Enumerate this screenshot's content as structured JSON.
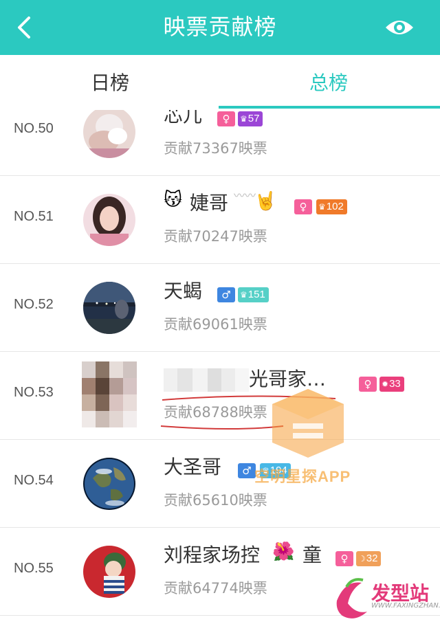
{
  "header": {
    "title": "映票贡献榜"
  },
  "tabs": [
    {
      "label": "日榜",
      "active": false
    },
    {
      "label": "总榜",
      "active": true
    }
  ],
  "accent_color": "#2bc9c0",
  "rows": [
    {
      "rank": "NO.50",
      "name": "芯儿",
      "sex": "♀",
      "level": "57",
      "level_icon": "crown-icon",
      "contribution": "贡献73367映票"
    },
    {
      "rank": "NO.51",
      "name": "婕哥",
      "sex": "♀",
      "level": "102",
      "level_icon": "crown-icon",
      "contribution": "贡献70247映票"
    },
    {
      "rank": "NO.52",
      "name": "天蝎",
      "sex": "♂",
      "level": "151",
      "level_icon": "crown-icon",
      "contribution": "贡献69061映票"
    },
    {
      "rank": "NO.53",
      "name": "光哥家…",
      "sex": "♀",
      "level": "33",
      "level_icon": "sun-icon",
      "contribution": "贡献68788映票"
    },
    {
      "rank": "NO.54",
      "name": "大圣哥",
      "sex": "♂",
      "level": "194",
      "level_icon": "crown-icon",
      "contribution": "贡献65610映票"
    },
    {
      "rank": "NO.55",
      "name": "刘程家场控",
      "name_suffix": "童",
      "sex": "♀",
      "level": "32",
      "level_icon": "moon-icon",
      "contribution": "贡献64774映票"
    }
  ],
  "watermarks": {
    "center": "空明星探APP",
    "corner": "发型站",
    "corner_url": "WWW.FAXINGZHAN.COM"
  }
}
